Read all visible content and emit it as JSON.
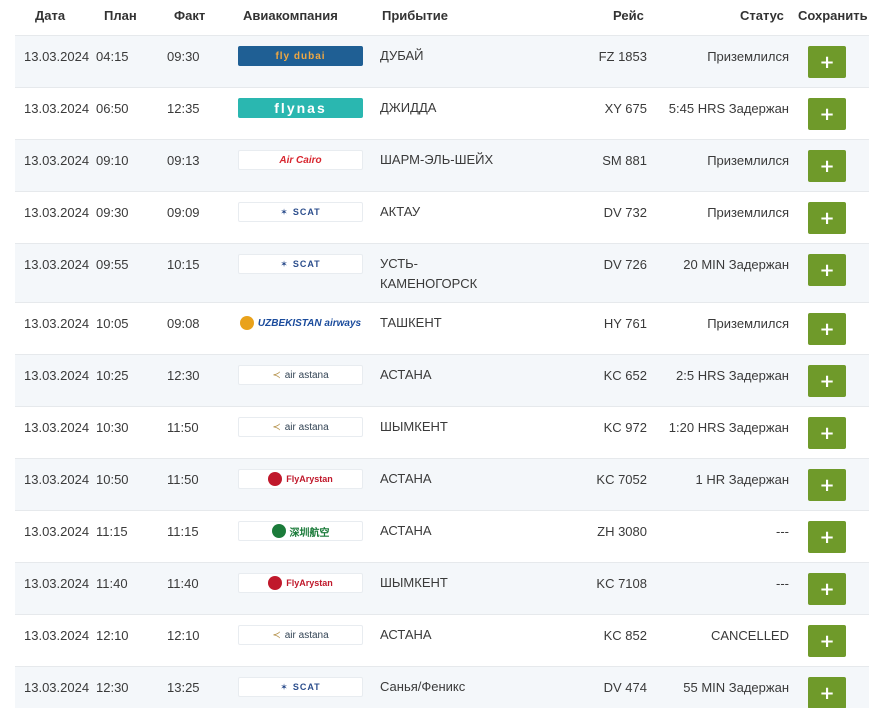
{
  "columns": {
    "date": "Дата",
    "plan": "План",
    "fact": "Факт",
    "airline": "Авиакомпания",
    "arrival": "Прибытие",
    "flight": "Рейс",
    "status": "Статус",
    "save": "Сохранить"
  },
  "save_button_label": "+",
  "rows": [
    {
      "date": "13.03.2024",
      "plan": "04:15",
      "fact": "09:30",
      "airline_logo": "flydubai",
      "logo_text": "fly dubai",
      "destination": "ДУБАЙ",
      "flight": "FZ 1853",
      "status": "Приземлился"
    },
    {
      "date": "13.03.2024",
      "plan": "06:50",
      "fact": "12:35",
      "airline_logo": "flynas",
      "logo_text": "flynas",
      "destination": "ДЖИДДА",
      "flight": "XY 675",
      "status": "5:45 HRS Задержан"
    },
    {
      "date": "13.03.2024",
      "plan": "09:10",
      "fact": "09:13",
      "airline_logo": "aircairo",
      "logo_text": "Air Cairo",
      "destination": "ШАРМ-ЭЛЬ-ШЕЙХ",
      "flight": "SM 881",
      "status": "Приземлился"
    },
    {
      "date": "13.03.2024",
      "plan": "09:30",
      "fact": "09:09",
      "airline_logo": "scat",
      "logo_text": "SCAT",
      "destination": "АКТАУ",
      "flight": "DV 732",
      "status": "Приземлился"
    },
    {
      "date": "13.03.2024",
      "plan": "09:55",
      "fact": "10:15",
      "airline_logo": "scat",
      "logo_text": "SCAT",
      "destination": "УСТЬ-КАМЕНОГОРСК",
      "flight": "DV 726",
      "status": "20 MIN Задержан"
    },
    {
      "date": "13.03.2024",
      "plan": "10:05",
      "fact": "09:08",
      "airline_logo": "uzbekistan",
      "logo_text": "UZBEKISTAN airways",
      "destination": "ТАШКЕНТ",
      "flight": "HY 761",
      "status": "Приземлился"
    },
    {
      "date": "13.03.2024",
      "plan": "10:25",
      "fact": "12:30",
      "airline_logo": "airastana",
      "logo_text": "air astana",
      "destination": "АСТАНА",
      "flight": "KC 652",
      "status": "2:5 HRS Задержан"
    },
    {
      "date": "13.03.2024",
      "plan": "10:30",
      "fact": "11:50",
      "airline_logo": "airastana",
      "logo_text": "air astana",
      "destination": "ШЫМКЕНТ",
      "flight": "KC 972",
      "status": "1:20 HRS Задержан"
    },
    {
      "date": "13.03.2024",
      "plan": "10:50",
      "fact": "11:50",
      "airline_logo": "flyarystan",
      "logo_text": "FlyArystan",
      "destination": "АСТАНА",
      "flight": "KC 7052",
      "status": "1 HR Задержан"
    },
    {
      "date": "13.03.2024",
      "plan": "11:15",
      "fact": "11:15",
      "airline_logo": "shenzhen",
      "logo_text": "深圳航空",
      "destination": "АСТАНА",
      "flight": "ZH 3080",
      "status": "---"
    },
    {
      "date": "13.03.2024",
      "plan": "11:40",
      "fact": "11:40",
      "airline_logo": "flyarystan",
      "logo_text": "FlyArystan",
      "destination": "ШЫМКЕНТ",
      "flight": "KC 7108",
      "status": "---"
    },
    {
      "date": "13.03.2024",
      "plan": "12:10",
      "fact": "12:10",
      "airline_logo": "airastana",
      "logo_text": "air astana",
      "destination": "АСТАНА",
      "flight": "KC 852",
      "status": "CANCELLED"
    },
    {
      "date": "13.03.2024",
      "plan": "12:30",
      "fact": "13:25",
      "airline_logo": "scat",
      "logo_text": "SCAT",
      "destination": "Санья/Феникс",
      "flight": "DV 474",
      "status": "55 MIN Задержан"
    }
  ],
  "colors": {
    "save_button": "#6f9a2a",
    "row_alt": "#f4f7fa",
    "flydubai": "#1f5f94",
    "flynas": "#2ab7b0"
  }
}
